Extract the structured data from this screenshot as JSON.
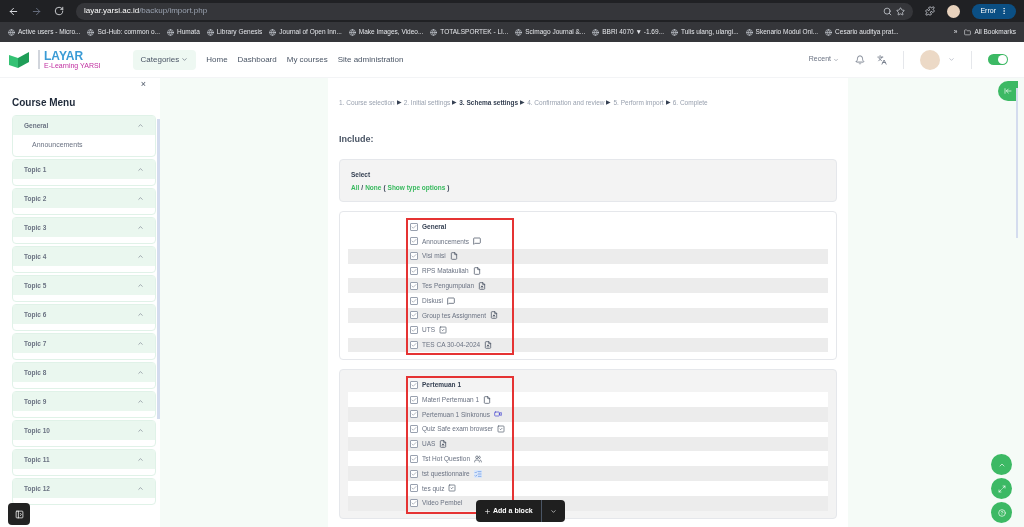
{
  "browser": {
    "url_host": "layar.yarsi.ac.id",
    "url_path": "/backup/import.php",
    "profile_button": "Error",
    "bookmarks": [
      {
        "label": "Active users - Micro..."
      },
      {
        "label": "Sci-Hub: common o..."
      },
      {
        "label": "Humata"
      },
      {
        "label": "Library Genesis"
      },
      {
        "label": "Journal of Open Inn..."
      },
      {
        "label": "Make Images, Video..."
      },
      {
        "label": "TOTALSPORTEK - LI..."
      },
      {
        "label": "Scimago Journal &..."
      },
      {
        "label": "BBRI 4070 ▼ -1.69..."
      },
      {
        "label": "Tulis ulang, ulangi..."
      },
      {
        "label": "Skenario Modul Onl..."
      },
      {
        "label": "Cesario auditya prat..."
      }
    ],
    "more": "»",
    "all_bookmarks": "All Bookmarks"
  },
  "site": {
    "logo_title": "LAYAR",
    "logo_subtitle": "E-Learning YARSI",
    "nav": [
      {
        "label": "Categories",
        "kind": "dropdown"
      },
      {
        "label": "Home",
        "kind": "link"
      },
      {
        "label": "Dashboard",
        "kind": "link"
      },
      {
        "label": "My courses",
        "kind": "link"
      },
      {
        "label": "Site administration",
        "kind": "link"
      }
    ],
    "recent": "Recent",
    "mode_toggle_on": true
  },
  "sidebar": {
    "title": "Course Menu",
    "close": "×",
    "sections": [
      {
        "label": "General",
        "expanded": true,
        "children": [
          {
            "label": "Announcements"
          }
        ]
      },
      {
        "label": "Topic 1",
        "expanded": true
      },
      {
        "label": "Topic 2",
        "expanded": true
      },
      {
        "label": "Topic 3",
        "expanded": true
      },
      {
        "label": "Topic 4",
        "expanded": true
      },
      {
        "label": "Topic 5",
        "expanded": true
      },
      {
        "label": "Topic 6",
        "expanded": true
      },
      {
        "label": "Topic 7",
        "expanded": true
      },
      {
        "label": "Topic 8",
        "expanded": true
      },
      {
        "label": "Topic 9",
        "expanded": true
      },
      {
        "label": "Topic 10",
        "expanded": true
      },
      {
        "label": "Topic 11",
        "expanded": true
      },
      {
        "label": "Topic 12",
        "expanded": true
      }
    ]
  },
  "steps": [
    {
      "label": "1. Course selection",
      "selected": false
    },
    {
      "arrow": "▶",
      "label": "2. Initial settings",
      "selected": false
    },
    {
      "arrow": "▶",
      "label": "3. Schema settings",
      "selected": true
    },
    {
      "arrow": "▶",
      "label": "4. Confirmation and review",
      "selected": false
    },
    {
      "arrow": "▶",
      "label": "5. Perform import",
      "selected": false
    },
    {
      "arrow": "▶",
      "label": "6. Complete",
      "selected": false
    }
  ],
  "include_heading": "Include:",
  "select_box": {
    "label": "Select",
    "all": "All",
    "separator": "/",
    "none": "None",
    "open": "(",
    "type_options": "Show type options",
    "close": ")"
  },
  "sections": [
    {
      "highlighted": true,
      "items": [
        {
          "label": "General",
          "kind": "section",
          "checked": true
        },
        {
          "label": "Announcements",
          "kind": "forum",
          "checked": true
        },
        {
          "label": "Visi misi",
          "kind": "page",
          "checked": true
        },
        {
          "label": "RPS Matakuliah",
          "kind": "page",
          "checked": true
        },
        {
          "label": "Tes Pengumpulan",
          "kind": "assign",
          "checked": true
        },
        {
          "label": "Diskusi",
          "kind": "forum",
          "checked": true
        },
        {
          "label": "Group tes Assignment",
          "kind": "assign",
          "checked": true
        },
        {
          "label": "UTS",
          "kind": "quiz",
          "checked": true
        },
        {
          "label": "TES CA 30-04-2024",
          "kind": "assign",
          "checked": true
        }
      ]
    },
    {
      "highlighted": true,
      "items": [
        {
          "label": "Pertemuan 1",
          "kind": "section",
          "checked": true
        },
        {
          "label": "Materi Pertemuan 1",
          "kind": "page",
          "checked": true
        },
        {
          "label": "Pertemuan 1 Sinkronus",
          "kind": "meeting",
          "checked": true
        },
        {
          "label": "Quiz Safe exam browser",
          "kind": "quiz",
          "checked": true
        },
        {
          "label": "UAS",
          "kind": "assign",
          "checked": true
        },
        {
          "label": "Tst Hot Question",
          "kind": "hotquestion",
          "checked": true
        },
        {
          "label": "tst questionnaire",
          "kind": "questionnaire",
          "checked": true
        },
        {
          "label": "tes quiz",
          "kind": "quiz",
          "checked": true
        },
        {
          "label": "Video Pembel",
          "kind": "none",
          "checked": true
        }
      ]
    }
  ],
  "add_block": "Add a block"
}
